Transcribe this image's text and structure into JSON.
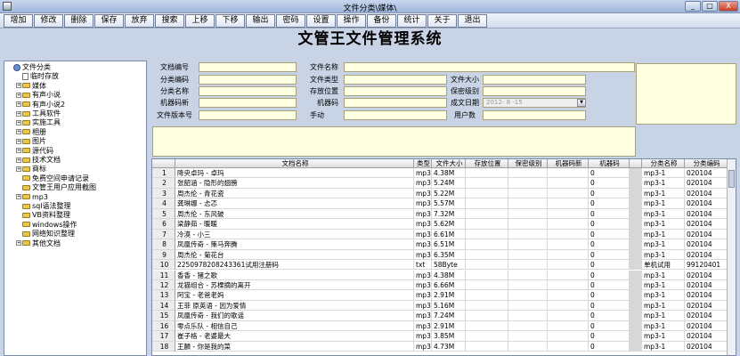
{
  "window": {
    "title": "文件分类\\媒体\\",
    "minimize": "_",
    "maximize": "□",
    "close": "X"
  },
  "toolbar": [
    "增加",
    "修改",
    "删除",
    "保存",
    "放弃",
    "搜索",
    "上移",
    "下移",
    "输出",
    "密码",
    "设置",
    "操作",
    "备份",
    "统计",
    "关于",
    "退出"
  ],
  "app_title": "文管王文件管理系统",
  "tree": [
    {
      "label": "文件分类",
      "indent": 0,
      "icon": "computer-icon",
      "exp": ""
    },
    {
      "label": "临时存放",
      "indent": 1,
      "icon": "document-icon",
      "exp": ""
    },
    {
      "label": "媒体",
      "indent": 1,
      "icon": "folder-icon",
      "exp": "+"
    },
    {
      "label": "有声小说",
      "indent": 1,
      "icon": "folder-icon",
      "exp": "+"
    },
    {
      "label": "有声小说2",
      "indent": 1,
      "icon": "folder-icon",
      "exp": "+"
    },
    {
      "label": "工具软件",
      "indent": 1,
      "icon": "folder-icon",
      "exp": "+"
    },
    {
      "label": "实施工具",
      "indent": 1,
      "icon": "folder-icon",
      "exp": "+"
    },
    {
      "label": "相册",
      "indent": 1,
      "icon": "folder-icon",
      "exp": "+"
    },
    {
      "label": "图片",
      "indent": 1,
      "icon": "folder-icon",
      "exp": "+"
    },
    {
      "label": "源代码",
      "indent": 1,
      "icon": "folder-icon",
      "exp": "+"
    },
    {
      "label": "技术文档",
      "indent": 1,
      "icon": "folder-icon",
      "exp": "+"
    },
    {
      "label": "商标",
      "indent": 1,
      "icon": "folder-icon",
      "exp": "+"
    },
    {
      "label": "免费空间申请记录",
      "indent": 1,
      "icon": "folder-icon",
      "exp": ""
    },
    {
      "label": "文管王用户应用截图",
      "indent": 1,
      "icon": "folder-icon",
      "exp": ""
    },
    {
      "label": "mp3",
      "indent": 1,
      "icon": "folder-icon",
      "exp": "+"
    },
    {
      "label": "sql语法整理",
      "indent": 1,
      "icon": "folder-icon",
      "exp": ""
    },
    {
      "label": "VB资料整理",
      "indent": 1,
      "icon": "folder-icon",
      "exp": ""
    },
    {
      "label": "windows操作",
      "indent": 1,
      "icon": "folder-icon",
      "exp": ""
    },
    {
      "label": "网络知识整理",
      "indent": 1,
      "icon": "folder-icon",
      "exp": ""
    },
    {
      "label": "其他文档",
      "indent": 1,
      "icon": "folder-icon",
      "exp": "+"
    }
  ],
  "form": {
    "fields": [
      {
        "label": "文档编号",
        "value": ""
      },
      {
        "label": "文件名称",
        "value": ""
      },
      {
        "label": "分类编码",
        "value": ""
      },
      {
        "label": "文件类型",
        "value": ""
      },
      {
        "label": "文件大小",
        "value": ""
      },
      {
        "label": "分类名称",
        "value": ""
      },
      {
        "label": "存放位置",
        "value": ""
      },
      {
        "label": "保密级别",
        "value": ""
      },
      {
        "label": "机器码新",
        "value": ""
      },
      {
        "label": "机器码",
        "value": ""
      },
      {
        "label": "成文日期",
        "value": "2012- 8 -15"
      },
      {
        "label": "文件版本号",
        "value": ""
      },
      {
        "label": "手动",
        "value": ""
      },
      {
        "label": "用户数",
        "value": ""
      }
    ]
  },
  "table": {
    "columns": [
      "文档名称",
      "类型",
      "文件大小",
      "存放位置",
      "保密级别",
      "机器码新",
      "机器码",
      "分类名称",
      "分类编码"
    ],
    "rows": [
      {
        "n": "1",
        "name": "降央卓玛 - 卓玛",
        "type": "mp3",
        "size": "4.38M",
        "m": "0",
        "cat": "mp3-1",
        "code": "020104"
      },
      {
        "n": "2",
        "name": "张韶涵 - 隐形的翅膀",
        "type": "mp3",
        "size": "5.24M",
        "m": "0",
        "cat": "mp3-1",
        "code": "020104"
      },
      {
        "n": "3",
        "name": "周杰伦 - 青花瓷",
        "type": "mp3",
        "size": "5.22M",
        "m": "0",
        "cat": "mp3-1",
        "code": "020104"
      },
      {
        "n": "4",
        "name": "龚琳娜 - 忐忑",
        "type": "mp3",
        "size": "5.57M",
        "m": "0",
        "cat": "mp3-1",
        "code": "020104"
      },
      {
        "n": "5",
        "name": "周杰伦 - 东风破",
        "type": "mp3",
        "size": "7.32M",
        "m": "0",
        "cat": "mp3-1",
        "code": "020104"
      },
      {
        "n": "6",
        "name": "梁静茹 - 暖暖",
        "type": "mp3",
        "size": "5.62M",
        "m": "0",
        "cat": "mp3-1",
        "code": "020104"
      },
      {
        "n": "7",
        "name": "冷漠 - 小三",
        "type": "mp3",
        "size": "6.61M",
        "m": "0",
        "cat": "mp3-1",
        "code": "020104"
      },
      {
        "n": "8",
        "name": "凤凰传奇 - 策马奔腾",
        "type": "mp3",
        "size": "6.51M",
        "m": "0",
        "cat": "mp3-1",
        "code": "020104"
      },
      {
        "n": "9",
        "name": "周杰伦 - 菊花台",
        "type": "mp3",
        "size": "6.35M",
        "m": "0",
        "cat": "mp3-1",
        "code": "020104"
      },
      {
        "n": "10",
        "name": "2250978208243361试用注册码",
        "type": "txt",
        "size": "58Byte",
        "m": "0",
        "cat": "单机试用",
        "code": "99120401"
      },
      {
        "n": "11",
        "name": "香香 - 猪之歌",
        "type": "mp3",
        "size": "4.38M",
        "m": "0",
        "cat": "mp3-1",
        "code": "020104"
      },
      {
        "n": "12",
        "name": "龙猫组合 - 苏棵摘的离开",
        "type": "mp3",
        "size": "6.66M",
        "m": "0",
        "cat": "mp3-1",
        "code": "020104"
      },
      {
        "n": "13",
        "name": "阿宝 - 老爸老妈",
        "type": "mp3",
        "size": "2.91M",
        "m": "0",
        "cat": "mp3-1",
        "code": "020104"
      },
      {
        "n": "14",
        "name": "王菲 原英语 - 因为爱情",
        "type": "mp3",
        "size": "5.16M",
        "m": "0",
        "cat": "mp3-1",
        "code": "020104"
      },
      {
        "n": "15",
        "name": "凤凰传奇 - 我们的歌谣",
        "type": "mp3",
        "size": "7.24M",
        "m": "0",
        "cat": "mp3-1",
        "code": "020104"
      },
      {
        "n": "16",
        "name": "零点乐队 - 相信自己",
        "type": "mp3",
        "size": "2.91M",
        "m": "0",
        "cat": "mp3-1",
        "code": "020104"
      },
      {
        "n": "17",
        "name": "崔子格 - 老婆最大",
        "type": "mp3",
        "size": "3.85M",
        "m": "0",
        "cat": "mp3-1",
        "code": "020104"
      },
      {
        "n": "18",
        "name": "王麟 - 你是我的菜",
        "type": "mp3",
        "size": "4.73M",
        "m": "0",
        "cat": "mp3-1",
        "code": "020104"
      }
    ]
  }
}
